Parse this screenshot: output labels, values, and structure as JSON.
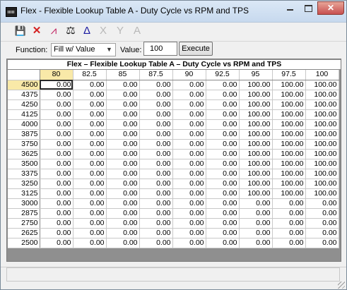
{
  "window": {
    "title": "Flex - Flexible Lookup Table A - Duty Cycle vs RPM and TPS"
  },
  "titlebar_buttons": {
    "close": "✕"
  },
  "toolbar": {
    "icons": [
      {
        "name": "save-icon",
        "glyph": "💾",
        "enabled": true
      },
      {
        "name": "delete-icon",
        "glyph": "✕",
        "enabled": true,
        "color": "#d42020"
      },
      {
        "name": "graph-icon",
        "glyph": "⩘",
        "enabled": true,
        "color": "#c02060"
      },
      {
        "name": "balance-icon",
        "glyph": "⚖",
        "enabled": true
      },
      {
        "name": "delta-icon",
        "glyph": "Δ",
        "enabled": true,
        "color": "#1a1aa0"
      },
      {
        "name": "scale-x-icon",
        "glyph": "X",
        "enabled": false
      },
      {
        "name": "scale-y-icon",
        "glyph": "Y",
        "enabled": false
      },
      {
        "name": "font-icon",
        "glyph": "A",
        "enabled": false
      }
    ]
  },
  "function_row": {
    "function_label": "Function:",
    "function_value": "Fill w/ Value",
    "value_label": "Value:",
    "value": "100",
    "execute_label": "Execute"
  },
  "table": {
    "title": "Flex – Flexible Lookup Table A – Duty Cycle vs RPM and TPS",
    "columns": [
      "80",
      "82.5",
      "85",
      "87.5",
      "90",
      "92.5",
      "95",
      "97.5",
      "100"
    ],
    "highlight_column": 0,
    "selected_row": 0,
    "rows": [
      {
        "rpm": "4500",
        "values": [
          "0.00",
          "0.00",
          "0.00",
          "0.00",
          "0.00",
          "0.00",
          "100.00",
          "100.00",
          "100.00"
        ]
      },
      {
        "rpm": "4375",
        "values": [
          "0.00",
          "0.00",
          "0.00",
          "0.00",
          "0.00",
          "0.00",
          "100.00",
          "100.00",
          "100.00"
        ]
      },
      {
        "rpm": "4250",
        "values": [
          "0.00",
          "0.00",
          "0.00",
          "0.00",
          "0.00",
          "0.00",
          "100.00",
          "100.00",
          "100.00"
        ]
      },
      {
        "rpm": "4125",
        "values": [
          "0.00",
          "0.00",
          "0.00",
          "0.00",
          "0.00",
          "0.00",
          "100.00",
          "100.00",
          "100.00"
        ]
      },
      {
        "rpm": "4000",
        "values": [
          "0.00",
          "0.00",
          "0.00",
          "0.00",
          "0.00",
          "0.00",
          "100.00",
          "100.00",
          "100.00"
        ]
      },
      {
        "rpm": "3875",
        "values": [
          "0.00",
          "0.00",
          "0.00",
          "0.00",
          "0.00",
          "0.00",
          "100.00",
          "100.00",
          "100.00"
        ]
      },
      {
        "rpm": "3750",
        "values": [
          "0.00",
          "0.00",
          "0.00",
          "0.00",
          "0.00",
          "0.00",
          "100.00",
          "100.00",
          "100.00"
        ]
      },
      {
        "rpm": "3625",
        "values": [
          "0.00",
          "0.00",
          "0.00",
          "0.00",
          "0.00",
          "0.00",
          "100.00",
          "100.00",
          "100.00"
        ]
      },
      {
        "rpm": "3500",
        "values": [
          "0.00",
          "0.00",
          "0.00",
          "0.00",
          "0.00",
          "0.00",
          "100.00",
          "100.00",
          "100.00"
        ]
      },
      {
        "rpm": "3375",
        "values": [
          "0.00",
          "0.00",
          "0.00",
          "0.00",
          "0.00",
          "0.00",
          "100.00",
          "100.00",
          "100.00"
        ]
      },
      {
        "rpm": "3250",
        "values": [
          "0.00",
          "0.00",
          "0.00",
          "0.00",
          "0.00",
          "0.00",
          "100.00",
          "100.00",
          "100.00"
        ]
      },
      {
        "rpm": "3125",
        "values": [
          "0.00",
          "0.00",
          "0.00",
          "0.00",
          "0.00",
          "0.00",
          "100.00",
          "100.00",
          "100.00"
        ]
      },
      {
        "rpm": "3000",
        "values": [
          "0.00",
          "0.00",
          "0.00",
          "0.00",
          "0.00",
          "0.00",
          "0.00",
          "0.00",
          "0.00"
        ]
      },
      {
        "rpm": "2875",
        "values": [
          "0.00",
          "0.00",
          "0.00",
          "0.00",
          "0.00",
          "0.00",
          "0.00",
          "0.00",
          "0.00"
        ]
      },
      {
        "rpm": "2750",
        "values": [
          "0.00",
          "0.00",
          "0.00",
          "0.00",
          "0.00",
          "0.00",
          "0.00",
          "0.00",
          "0.00"
        ]
      },
      {
        "rpm": "2625",
        "values": [
          "0.00",
          "0.00",
          "0.00",
          "0.00",
          "0.00",
          "0.00",
          "0.00",
          "0.00",
          "0.00"
        ]
      },
      {
        "rpm": "2500",
        "values": [
          "0.00",
          "0.00",
          "0.00",
          "0.00",
          "0.00",
          "0.00",
          "0.00",
          "0.00",
          "0.00"
        ]
      }
    ]
  },
  "status": {
    "text": ""
  }
}
